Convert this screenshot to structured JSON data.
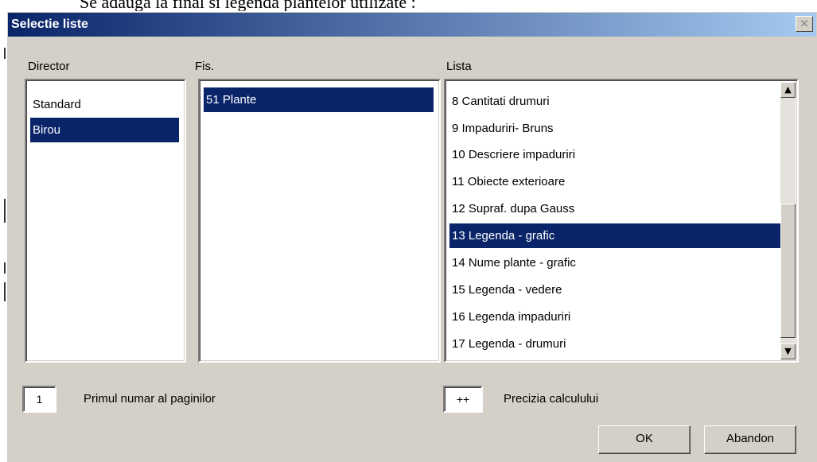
{
  "document": {
    "text_above": "Se adauga la final si legenda plantelor utilizate :"
  },
  "dialog": {
    "title": "Selectie liste",
    "close_glyph": "×",
    "director": {
      "label": "Director",
      "items": [
        "Standard",
        "Birou"
      ],
      "selected_index": 1
    },
    "fis": {
      "label": "Fis.",
      "items": [
        "51 Plante"
      ],
      "selected_index": 0
    },
    "lista": {
      "label": "Lista",
      "items": [
        "8 Cantitati drumuri",
        "9 Impaduriri- Bruns",
        "10 Descriere impaduriri",
        "11 Obiecte exterioare",
        "12 Supraf. dupa Gauss",
        "13 Legenda - grafic",
        "14 Nume plante - grafic",
        "15 Legenda - vedere",
        "16 Legenda impaduriri",
        "17 Legenda - drumuri"
      ],
      "selected_index": 5,
      "scroll_up_glyph": "▲",
      "scroll_down_glyph": "▼"
    },
    "page_number": {
      "value": "1",
      "label": "Primul numar al paginilor"
    },
    "precision": {
      "value": "++",
      "label": "Precizia calculului"
    },
    "ok_label": "OK",
    "cancel_label": "Abandon"
  }
}
